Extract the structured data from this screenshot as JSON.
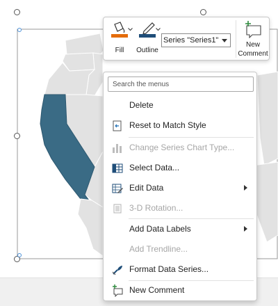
{
  "colors": {
    "map_land": "#e2e2e2",
    "map_border": "#ffffff",
    "highlight_state": "#3a6b85",
    "fill_accent": "#e46c0a",
    "outline_accent": "#1f4e79"
  },
  "toolbar": {
    "fill_label": "Fill",
    "outline_label": "Outline",
    "series_value": "Series \"Series1\"",
    "new_comment_line1": "New",
    "new_comment_line2": "Comment"
  },
  "menu": {
    "search_placeholder": "Search the menus",
    "items": [
      {
        "label": "Delete",
        "icon": "none",
        "disabled": false
      },
      {
        "label": "Reset to Match Style",
        "icon": "reset-style-icon",
        "disabled": false
      },
      {
        "label": "Change Series Chart Type...",
        "icon": "chart-type-icon",
        "disabled": true
      },
      {
        "label": "Select Data...",
        "icon": "select-data-icon",
        "disabled": false
      },
      {
        "label": "Edit Data",
        "icon": "edit-data-icon",
        "disabled": false,
        "submenu": true
      },
      {
        "label": "3-D Rotation...",
        "icon": "rotation-3d-icon",
        "disabled": true
      },
      {
        "label": "Add Data Labels",
        "icon": "none",
        "disabled": false,
        "submenu": true
      },
      {
        "label": "Add Trendline...",
        "icon": "none",
        "disabled": true
      },
      {
        "label": "Format Data Series...",
        "icon": "format-series-icon",
        "disabled": false
      },
      {
        "label": "New Comment",
        "icon": "new-comment-icon",
        "disabled": false
      }
    ]
  }
}
